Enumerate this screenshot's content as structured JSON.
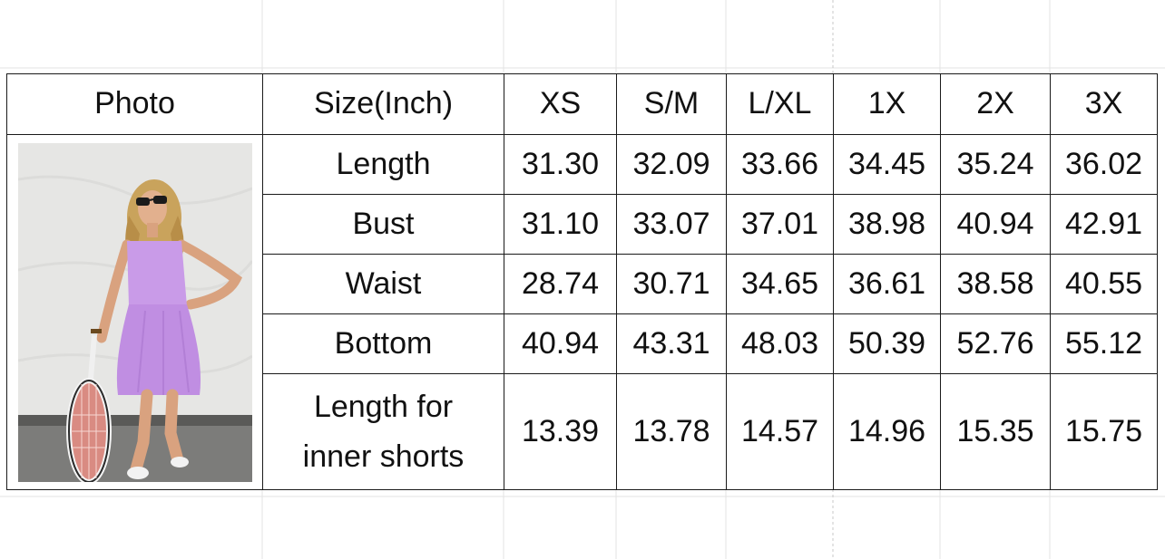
{
  "table": {
    "header": {
      "photo_label": "Photo",
      "size_label": "Size(Inch)",
      "sizes": [
        "XS",
        "S/M",
        "L/XL",
        "1X",
        "2X",
        "3X"
      ]
    },
    "rows": [
      {
        "label": "Length",
        "values": [
          "31.30",
          "32.09",
          "33.66",
          "34.45",
          "35.24",
          "36.02"
        ]
      },
      {
        "label": "Bust",
        "values": [
          "31.10",
          "33.07",
          "37.01",
          "38.98",
          "40.94",
          "42.91"
        ]
      },
      {
        "label": "Waist",
        "values": [
          "28.74",
          "30.71",
          "34.65",
          "36.61",
          "38.58",
          "40.55"
        ]
      },
      {
        "label": "Bottom",
        "values": [
          "40.94",
          "43.31",
          "48.03",
          "50.39",
          "52.76",
          "55.12"
        ]
      },
      {
        "label_line1": "Length for",
        "label_line2": "inner shorts",
        "values": [
          "13.39",
          "13.78",
          "14.57",
          "14.96",
          "15.35",
          "15.75"
        ]
      }
    ]
  },
  "photo": {
    "subject": "woman in lavender tennis dress holding a tennis racket",
    "dress_color": "#c99be8",
    "wall_color": "#e8e8e6",
    "ground_color": "#7a7a78"
  }
}
